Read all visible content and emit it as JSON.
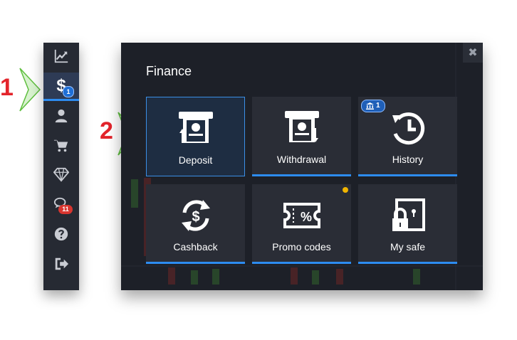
{
  "callouts": {
    "first": "1",
    "second": "2"
  },
  "sidebar": {
    "items": [
      {
        "name": "chart",
        "icon": "chart-icon"
      },
      {
        "name": "finance",
        "icon": "dollar-icon",
        "symbol": "$",
        "badge": "1"
      },
      {
        "name": "profile",
        "icon": "user-icon"
      },
      {
        "name": "market",
        "icon": "cart-icon"
      },
      {
        "name": "achievements",
        "icon": "diamond-icon"
      },
      {
        "name": "chat",
        "icon": "chat-icon",
        "badge": "11"
      },
      {
        "name": "help",
        "icon": "help-icon"
      },
      {
        "name": "logout",
        "icon": "logout-icon"
      }
    ]
  },
  "modal": {
    "title": "Finance",
    "close_symbol": "✖",
    "tiles": [
      {
        "label": "Deposit",
        "icon": "deposit-icon",
        "selected": true
      },
      {
        "label": "Withdrawal",
        "icon": "withdrawal-icon"
      },
      {
        "label": "History",
        "icon": "history-icon",
        "badge": "1"
      },
      {
        "label": "Cashback",
        "icon": "cashback-icon"
      },
      {
        "label": "Promo codes",
        "icon": "promo-codes-icon"
      },
      {
        "label": "My safe",
        "icon": "safe-icon"
      }
    ]
  },
  "colors": {
    "accent": "#2d8cf0",
    "callout": "#e3242b",
    "panel": "#1d2028",
    "tile": "#2a2d36"
  }
}
